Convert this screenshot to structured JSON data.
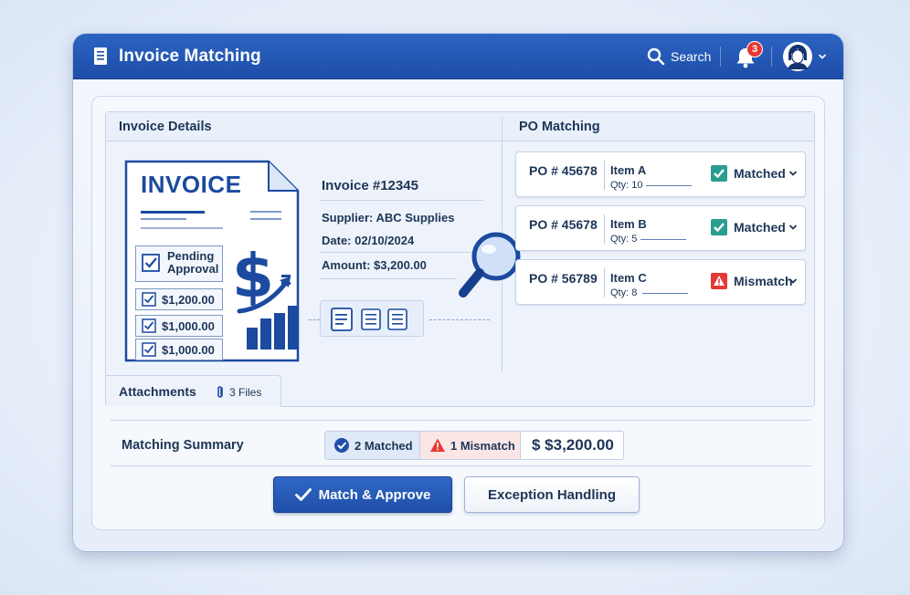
{
  "app": {
    "title": "Invoice Matching"
  },
  "header": {
    "search_label": "Search",
    "notification_count": "3"
  },
  "invoice_details": {
    "section_title": "Invoice Details",
    "doc_title": "INVOICE",
    "status_label": "Pending Approval",
    "line_amounts": [
      "$1,200.00",
      "$1,000.00",
      "$1,000.00"
    ],
    "invoice_number": "Invoice #12345",
    "supplier": "Supplier: ABC Supplies",
    "date": "Date: 02/10/2024",
    "amount": "Amount: $3,200.00"
  },
  "po_matching": {
    "section_title": "PO Matching",
    "rows": [
      {
        "po": "PO # 45678",
        "item": "Item A",
        "qty": "Qty: 10",
        "status": "Matched",
        "status_color": "#2a9d8f"
      },
      {
        "po": "PO # 45678",
        "item": "Item B",
        "qty": "Qty: 5",
        "status": "Matched",
        "status_color": "#2a9d8f"
      },
      {
        "po": "PO # 56789",
        "item": "Item C",
        "qty": "Qty: 8",
        "status": "Mismatch",
        "status_color": "#e53935"
      }
    ]
  },
  "attachments": {
    "label": "Attachments",
    "count": "3 Files"
  },
  "summary": {
    "title": "Matching Summary",
    "matched": "2 Matched",
    "mismatch": "1 Mismatch",
    "total": "$ $3,200.00"
  },
  "actions": {
    "primary": "Match & Approve",
    "secondary": "Exception Handling"
  },
  "colors": {
    "brand": "#1f4fa8",
    "match": "#2a9d8f",
    "mismatch": "#e53935",
    "text": "#1d3557"
  }
}
